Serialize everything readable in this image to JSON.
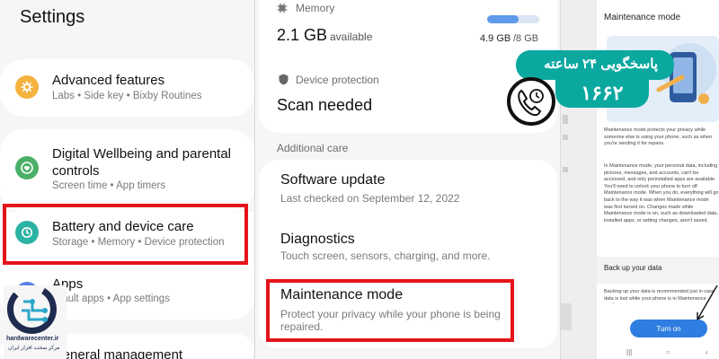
{
  "left": {
    "title": "Settings",
    "items": [
      {
        "name": "Advanced features",
        "sub": "Labs  •  Side key  •  Bixby Routines",
        "icon": "gear-plus-icon",
        "color": "#f4b23e"
      },
      {
        "name": "Digital Wellbeing and parental controls",
        "name_line1": "Digital Wellbeing and parental",
        "name_line2": "controls",
        "sub": "Screen time  •  App timers",
        "icon": "wellbeing-heart-icon",
        "color": "#4caf68"
      },
      {
        "name": "Battery and device care",
        "sub": "Storage  •  Memory  •  Device protection",
        "icon": "device-care-icon",
        "color": "#2bb3a3"
      },
      {
        "name": "Apps",
        "sub": "Default apps  •  App settings",
        "sub_visible": "fault apps  •  App settings",
        "icon": "apps-grid-icon",
        "color": "#5b7fe6"
      },
      {
        "name": "General management",
        "icon": "sliders-icon",
        "color": "#6e7a8a"
      }
    ],
    "logo": {
      "line1": "hardwarecenter.ir",
      "line2": "مرکز سخت افزار ایران"
    }
  },
  "middle": {
    "memory_label": "Memory",
    "memory_value": "2.1 GB",
    "memory_available": "available",
    "memory_used": "4.9 GB",
    "memory_total": "/8 GB",
    "memory_fill": 0.61,
    "protection_label": "Device protection",
    "protection_status": "Scan needed",
    "additional_care": "Additional care",
    "software_update": {
      "name": "Software update",
      "sub": "Last checked on September 12, 2022"
    },
    "diagnostics": {
      "name": "Diagnostics",
      "sub": "Touch screen, sensors, charging, and more."
    },
    "maintenance": {
      "name": "Maintenance mode",
      "sub_line1": "Protect your privacy while your phone is being",
      "sub_line2": "repaired."
    }
  },
  "right": {
    "header": "Maintenance mode",
    "intro": "Maintenance mode protects your privacy while someone else is using your phone, such as when you're sending it for repairs.",
    "body": "In Maintenance mode, your personal data, including pictures, messages, and accounts, can't be accessed, and only preinstalled apps are available. You'll need to unlock your phone to turn off Maintenance mode. When you do, everything will go back to the way it was when Maintenance mode was first turned on. Changes made while Maintenance mode is on, such as downloaded data, installed apps, or setting changes, aren't saved.",
    "backup_title": "Back up your data",
    "backup_text": "Backing up your data is recommended just in case data is lost while your phone is in Maintenance mode.",
    "turn_on": "Turn on"
  },
  "banner": {
    "text": "پاسخگویی ۲۴ ساعته",
    "number": "۱۶۶۲",
    "color": "#0ba8a0"
  },
  "highlight_color": "#e5141b"
}
